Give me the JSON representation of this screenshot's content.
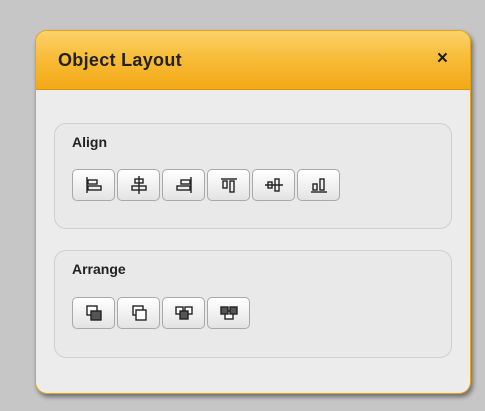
{
  "dialog": {
    "title": "Object Layout",
    "close_label": "×"
  },
  "align": {
    "label": "Align",
    "buttons": [
      {
        "icon": "align-left-icon"
      },
      {
        "icon": "align-center-icon"
      },
      {
        "icon": "align-right-icon"
      },
      {
        "icon": "align-top-icon"
      },
      {
        "icon": "align-middle-icon"
      },
      {
        "icon": "align-bottom-icon"
      }
    ]
  },
  "arrange": {
    "label": "Arrange",
    "buttons": [
      {
        "icon": "bring-to-front-icon"
      },
      {
        "icon": "send-to-back-icon"
      },
      {
        "icon": "bring-forward-icon"
      },
      {
        "icon": "send-backward-icon"
      }
    ]
  },
  "colors": {
    "titlebar": "#f8bd3a",
    "border": "#e8a214",
    "panel": "#ececec"
  }
}
